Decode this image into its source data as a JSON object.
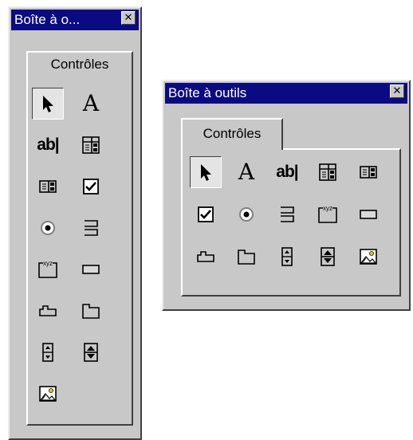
{
  "window_left": {
    "title": "Boîte à o...",
    "close_glyph": "✕",
    "tab_label": "Contrôles",
    "tools": [
      {
        "name": "pointer-icon",
        "label": "",
        "pressed": true
      },
      {
        "name": "label-icon",
        "label": "A",
        "pressed": false
      },
      {
        "name": "textbox-icon",
        "label": "ab|",
        "pressed": false
      },
      {
        "name": "combobox-icon",
        "label": "",
        "pressed": false
      },
      {
        "name": "listbox-icon",
        "label": "",
        "pressed": false
      },
      {
        "name": "checkbox-icon",
        "label": "",
        "pressed": false
      },
      {
        "name": "option-button-icon",
        "label": "",
        "pressed": false
      },
      {
        "name": "toggle-button-icon",
        "label": "",
        "pressed": false
      },
      {
        "name": "frame-icon",
        "label": "xyz",
        "pressed": false
      },
      {
        "name": "command-button-icon",
        "label": "",
        "pressed": false
      },
      {
        "name": "tabstrip-icon",
        "label": "",
        "pressed": false
      },
      {
        "name": "multipage-icon",
        "label": "",
        "pressed": false
      },
      {
        "name": "scrollbar-icon",
        "label": "",
        "pressed": false
      },
      {
        "name": "spinbutton-icon",
        "label": "",
        "pressed": false
      },
      {
        "name": "image-icon",
        "label": "",
        "pressed": false
      }
    ]
  },
  "window_right": {
    "title": "Boîte à outils",
    "close_glyph": "✕",
    "tab_label": "Contrôles",
    "tools": [
      {
        "name": "pointer-icon",
        "label": "",
        "pressed": true
      },
      {
        "name": "label-icon",
        "label": "A",
        "pressed": false
      },
      {
        "name": "textbox-icon",
        "label": "ab|",
        "pressed": false
      },
      {
        "name": "combobox-icon",
        "label": "",
        "pressed": false
      },
      {
        "name": "listbox-icon",
        "label": "",
        "pressed": false
      },
      {
        "name": "checkbox-icon",
        "label": "",
        "pressed": false
      },
      {
        "name": "option-button-icon",
        "label": "",
        "pressed": false
      },
      {
        "name": "toggle-button-icon",
        "label": "",
        "pressed": false
      },
      {
        "name": "frame-icon",
        "label": "xyz",
        "pressed": false
      },
      {
        "name": "command-button-icon",
        "label": "",
        "pressed": false
      },
      {
        "name": "tabstrip-icon",
        "label": "",
        "pressed": false
      },
      {
        "name": "multipage-icon",
        "label": "",
        "pressed": false
      },
      {
        "name": "scrollbar-icon",
        "label": "",
        "pressed": false
      },
      {
        "name": "spinbutton-icon",
        "label": "",
        "pressed": false
      },
      {
        "name": "image-icon",
        "label": "",
        "pressed": false
      }
    ]
  },
  "colors": {
    "titlebar": "#0a0a82",
    "face": "#c8c8c8",
    "highlight": "#ffffff",
    "shadow": "#404040"
  }
}
